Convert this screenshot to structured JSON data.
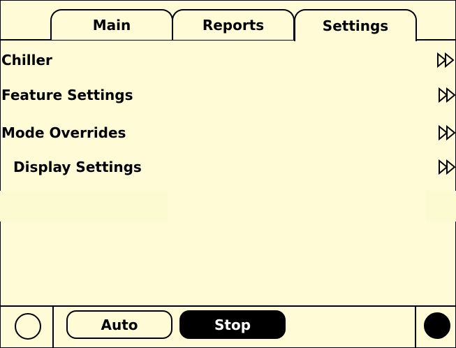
{
  "tabs": [
    {
      "label": "Main",
      "active": false
    },
    {
      "label": "Reports",
      "active": false
    },
    {
      "label": "Settings",
      "active": true
    }
  ],
  "menu": [
    {
      "label": "Chiller",
      "icon": "double-arrow-right-icon"
    },
    {
      "label": "Feature Settings",
      "icon": "double-arrow-right-icon"
    },
    {
      "label": "Mode Overrides",
      "icon": "double-arrow-right-icon"
    },
    {
      "label": "Display Settings",
      "icon": "double-arrow-right-icon"
    }
  ],
  "bottom": {
    "auto_label": "Auto",
    "stop_label": "Stop",
    "stop_selected": true,
    "left_indicator": "off",
    "right_indicator": "on"
  },
  "colors": {
    "background": "#fffbd6",
    "foreground": "#000000",
    "selected_button_text": "#ffffff"
  }
}
